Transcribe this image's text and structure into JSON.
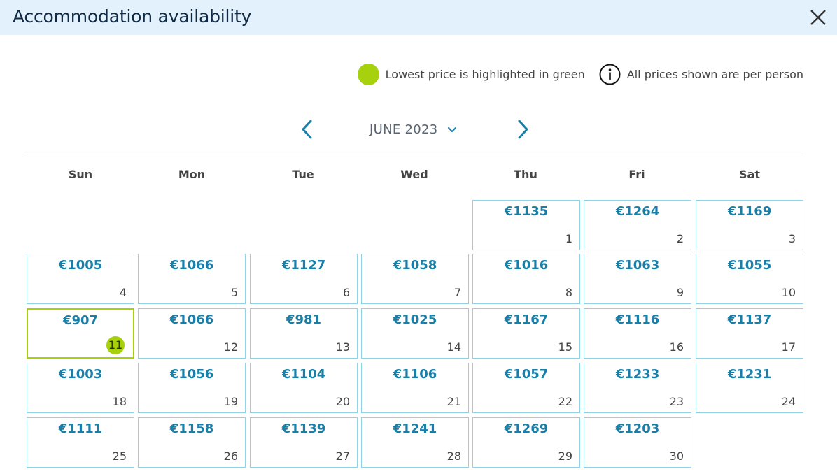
{
  "header": {
    "title": "Accommodation availability"
  },
  "legend": {
    "lowest_text": "Lowest price is highlighted in green",
    "per_person_text": "All prices shown are per person",
    "highlight_color": "#a6d10c"
  },
  "calendar": {
    "month_label": "JUNE 2023",
    "weekdays": [
      "Sun",
      "Mon",
      "Tue",
      "Wed",
      "Thu",
      "Fri",
      "Sat"
    ],
    "first_weekday_index": 4,
    "lowest_day": 11,
    "days": [
      {
        "day": "1",
        "price": "€1135"
      },
      {
        "day": "2",
        "price": "€1264"
      },
      {
        "day": "3",
        "price": "€1169"
      },
      {
        "day": "4",
        "price": "€1005"
      },
      {
        "day": "5",
        "price": "€1066"
      },
      {
        "day": "6",
        "price": "€1127"
      },
      {
        "day": "7",
        "price": "€1058"
      },
      {
        "day": "8",
        "price": "€1016"
      },
      {
        "day": "9",
        "price": "€1063"
      },
      {
        "day": "10",
        "price": "€1055"
      },
      {
        "day": "11",
        "price": "€907"
      },
      {
        "day": "12",
        "price": "€1066"
      },
      {
        "day": "13",
        "price": "€981"
      },
      {
        "day": "14",
        "price": "€1025"
      },
      {
        "day": "15",
        "price": "€1167"
      },
      {
        "day": "16",
        "price": "€1116"
      },
      {
        "day": "17",
        "price": "€1137"
      },
      {
        "day": "18",
        "price": "€1003"
      },
      {
        "day": "19",
        "price": "€1056"
      },
      {
        "day": "20",
        "price": "€1104"
      },
      {
        "day": "21",
        "price": "€1106"
      },
      {
        "day": "22",
        "price": "€1057"
      },
      {
        "day": "23",
        "price": "€1233"
      },
      {
        "day": "24",
        "price": "€1231"
      },
      {
        "day": "25",
        "price": "€1111"
      },
      {
        "day": "26",
        "price": "€1158"
      },
      {
        "day": "27",
        "price": "€1139"
      },
      {
        "day": "28",
        "price": "€1241"
      },
      {
        "day": "29",
        "price": "€1269"
      },
      {
        "day": "30",
        "price": "€1203"
      }
    ]
  },
  "colors": {
    "header_bg": "#e2f1fb",
    "price_text": "#1a7fa8",
    "cell_border": "#8fd2e3",
    "nav_arrow": "#1a7fa8"
  },
  "icons": {
    "close": "close-icon",
    "info": "info-icon",
    "prev": "chevron-left-icon",
    "next": "chevron-right-icon",
    "dropdown": "chevron-down-icon"
  }
}
